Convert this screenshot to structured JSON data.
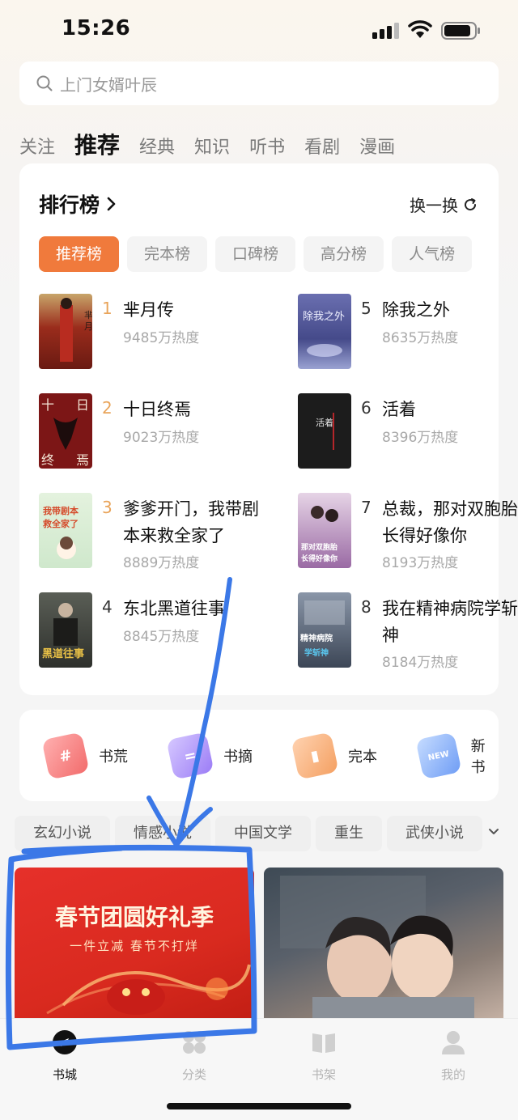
{
  "status_bar": {
    "time": "15:26"
  },
  "search": {
    "placeholder": "上门女婿叶辰"
  },
  "tabs": [
    {
      "label": "关注",
      "active": false
    },
    {
      "label": "推荐",
      "active": true
    },
    {
      "label": "经典",
      "active": false
    },
    {
      "label": "知识",
      "active": false
    },
    {
      "label": "听书",
      "active": false
    },
    {
      "label": "看剧",
      "active": false
    },
    {
      "label": "漫画",
      "active": false
    }
  ],
  "ranking": {
    "title": "排行榜",
    "refresh_label": "换一换",
    "categories": [
      "推荐榜",
      "完本榜",
      "口碑榜",
      "高分榜",
      "人气榜"
    ],
    "active_category": "推荐榜",
    "books": [
      {
        "rank": "1",
        "name": "芈月传",
        "heat": "9485万热度"
      },
      {
        "rank": "2",
        "name": "十日终焉",
        "heat": "9023万热度"
      },
      {
        "rank": "3",
        "name": "爹爹开门，我带剧本来救全家了",
        "heat": "8889万热度"
      },
      {
        "rank": "4",
        "name": "东北黑道往事",
        "heat": "8845万热度"
      },
      {
        "rank": "5",
        "name": "除我之外",
        "heat": "8635万热度"
      },
      {
        "rank": "6",
        "name": "活着",
        "heat": "8396万热度"
      },
      {
        "rank": "7",
        "name": "总裁，那对双胞胎长得好像你",
        "heat": "8193万热度"
      },
      {
        "rank": "8",
        "name": "我在精神病院学斩神",
        "heat": "8184万热度"
      }
    ],
    "covers": [
      {
        "text": "芈月传",
        "bg": "#8b2a1e"
      },
      {
        "text": "十日终焉",
        "bg": "#7b1414"
      },
      {
        "text": "我带剧本来救全家了",
        "bg": "#d8ecd6"
      },
      {
        "text": "黑道往事",
        "bg": "#3a3c36"
      },
      {
        "text": "除我之外",
        "bg": "#4a4e8c"
      },
      {
        "text": "活着",
        "bg": "#1e1e1e"
      },
      {
        "text": "那对双胞胎长得好像你",
        "bg": "#6e5a82"
      },
      {
        "text": "精神病院学斩神",
        "bg": "#3c4656"
      }
    ]
  },
  "quick_categories": [
    {
      "label": "书荒",
      "icon": "hashtag-icon",
      "color": "#f26b6b"
    },
    {
      "label": "书摘",
      "icon": "excerpt-icon",
      "color": "#9b7cf6"
    },
    {
      "label": "完本",
      "icon": "finished-book-icon",
      "color": "#f4a062"
    },
    {
      "label": "新书",
      "icon": "new-flag-icon",
      "color": "#6f9df5"
    }
  ],
  "genres": [
    "玄幻小说",
    "情感小说",
    "中国文学",
    "重生",
    "武侠小说"
  ],
  "banners": {
    "left": {
      "title": "春节团圆好礼季",
      "subtitle": "一件立减 春节不打烊"
    }
  },
  "bottom_nav": [
    {
      "label": "书城",
      "active": true
    },
    {
      "label": "分类",
      "active": false
    },
    {
      "label": "书架",
      "active": false
    },
    {
      "label": "我的",
      "active": false
    }
  ],
  "colors": {
    "accent": "#f07a3c",
    "annotation": "#3b78e7"
  }
}
